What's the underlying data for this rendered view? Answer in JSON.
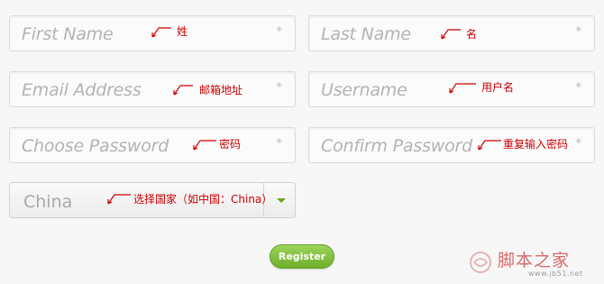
{
  "form": {
    "first_name": {
      "placeholder": "First Name",
      "annotation": "姓"
    },
    "last_name": {
      "placeholder": "Last Name",
      "annotation": "名"
    },
    "email": {
      "placeholder": "Email Address",
      "annotation": "邮箱地址"
    },
    "username": {
      "placeholder": "Username",
      "annotation": "用户名"
    },
    "password": {
      "placeholder": "Choose Password",
      "annotation": "密码"
    },
    "confirm_password": {
      "placeholder": "Confirm Password",
      "annotation": "重复输入密码"
    },
    "country": {
      "value": "China",
      "annotation": "选择国家（如中国：China）"
    },
    "required_marker": "*",
    "register_label": "Register"
  },
  "watermark": {
    "site_name": "脚本之家",
    "url": "www.jb51.net"
  },
  "colors": {
    "annotation": "#cc0000",
    "button": "#7fbf3a",
    "caret": "#6aa322"
  }
}
